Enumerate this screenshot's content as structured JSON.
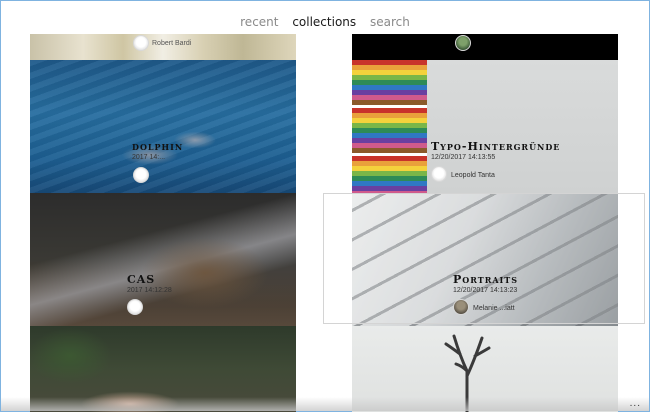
{
  "nav": {
    "items": [
      {
        "label": "recent",
        "active": false
      },
      {
        "label": "collections",
        "active": true
      },
      {
        "label": "search",
        "active": false
      }
    ]
  },
  "collections": {
    "left": [
      {
        "title": "",
        "date": "",
        "author": "Robert Bardi"
      },
      {
        "title": "dolphin",
        "date": "2017 14:...",
        "author": ""
      },
      {
        "title": "CAS",
        "date": "2017 14:12:28",
        "author": ""
      },
      {
        "title": "",
        "date": "",
        "author": ""
      }
    ],
    "right": [
      {
        "title": "",
        "date": "",
        "author": ""
      },
      {
        "title": "Typo-Hintergründe",
        "date": "12/20/2017 14:13:55",
        "author": "Leopold Tanta"
      },
      {
        "title": "Portraits",
        "date": "12/20/2017 14:13:23",
        "author": "Melanie ...iatt"
      },
      {
        "title": "",
        "date": "",
        "author": ""
      }
    ]
  },
  "footer": {
    "more_label": "..."
  },
  "colors": {
    "accent": "#1a1a1a",
    "nav_inactive": "#8a8a8a",
    "window_border": "#7fb3e0"
  }
}
